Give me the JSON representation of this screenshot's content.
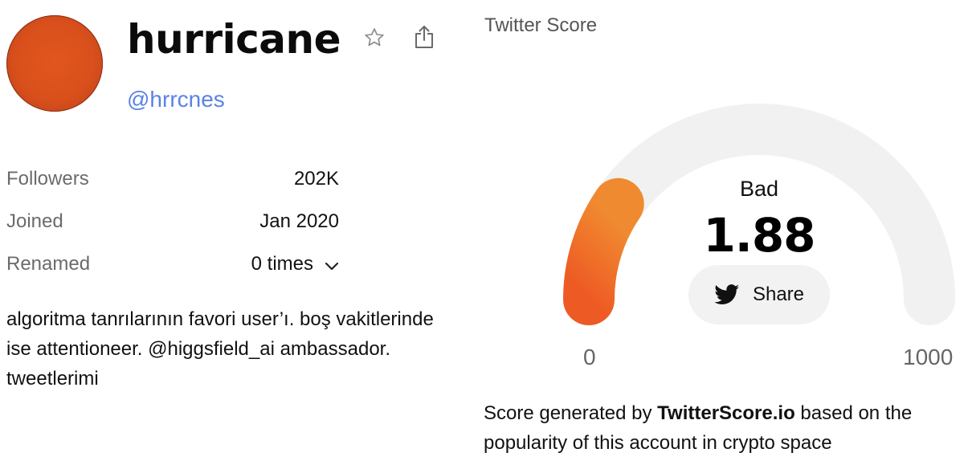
{
  "profile": {
    "name": "hurricane",
    "handle": "@hrrcnes",
    "stats": {
      "followers_label": "Followers",
      "followers_value": "202K",
      "joined_label": "Joined",
      "joined_value": "Jan 2020",
      "renamed_label": "Renamed",
      "renamed_value": "0 times"
    },
    "bio": "algoritma tanrılarının favori user’ı. boş vakitlerinde ise attentioneer. @higgsfield_ai ambassador. tweetlerimi"
  },
  "score": {
    "title": "Twitter Score",
    "status": "Bad",
    "value": "1.88",
    "numeric_value": 1.88,
    "gauge_fill_fraction": 0.19,
    "min_label": "0",
    "max_label": "1000",
    "share_label": "Share",
    "footer_prefix": "Score generated by ",
    "footer_brand": "TwitterScore.io",
    "footer_suffix": " based on the popularity of this account in crypto space"
  },
  "icons": {
    "favorite": "star-icon",
    "share": "share-icon",
    "expand": "chevron-down-icon",
    "twitter": "twitter-icon"
  },
  "colors": {
    "handle": "#5b82e6",
    "gauge_track": "#f1f1f1",
    "gauge_fill_start": "#ee5a24",
    "gauge_fill_end": "#f08a30",
    "avatar": "#d9501c"
  }
}
